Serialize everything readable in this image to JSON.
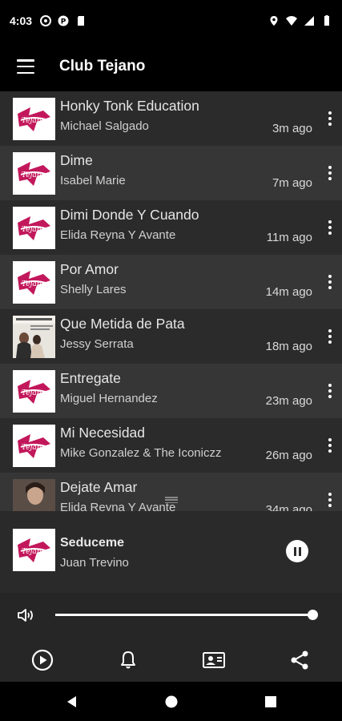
{
  "status_bar": {
    "time": "4:03"
  },
  "app_bar": {
    "title": "Club Tejano"
  },
  "songs": [
    {
      "title": "Honky Tonk Education",
      "artist": "Michael Salgado",
      "time": "3m ago",
      "thumb": "tejano-logo"
    },
    {
      "title": "Dime",
      "artist": "Isabel Marie",
      "time": "7m ago",
      "thumb": "tejano-logo"
    },
    {
      "title": "Dimi Donde Y Cuando",
      "artist": "Elida Reyna Y Avante",
      "time": "11m ago",
      "thumb": "tejano-logo"
    },
    {
      "title": "Por Amor",
      "artist": "Shelly Lares",
      "time": "14m ago",
      "thumb": "tejano-logo"
    },
    {
      "title": "Que Metida de Pata",
      "artist": "Jessy Serrata",
      "time": "18m ago",
      "thumb": "album-photo"
    },
    {
      "title": "Entregate",
      "artist": "Miguel Hernandez",
      "time": "23m ago",
      "thumb": "tejano-logo"
    },
    {
      "title": "Mi Necesidad",
      "artist": "Mike Gonzalez & The Iconiczz",
      "time": "26m ago",
      "thumb": "tejano-logo"
    },
    {
      "title": "Dejate Amar",
      "artist": "Elida Reyna Y Avante",
      "time": "34m ago",
      "thumb": "portrait-photo"
    }
  ],
  "now_playing": {
    "title": "Seduceme",
    "artist": "Juan Trevino",
    "state": "playing"
  },
  "volume": {
    "level": 1.0
  },
  "bottom_bar": {
    "icons": [
      "play-circle-icon",
      "bell-icon",
      "contact-card-icon",
      "share-icon"
    ]
  },
  "colors": {
    "background": "#000000",
    "row_dark": "#2b2b2b",
    "row_light": "#363636",
    "logo_pink": "#c2185b"
  }
}
